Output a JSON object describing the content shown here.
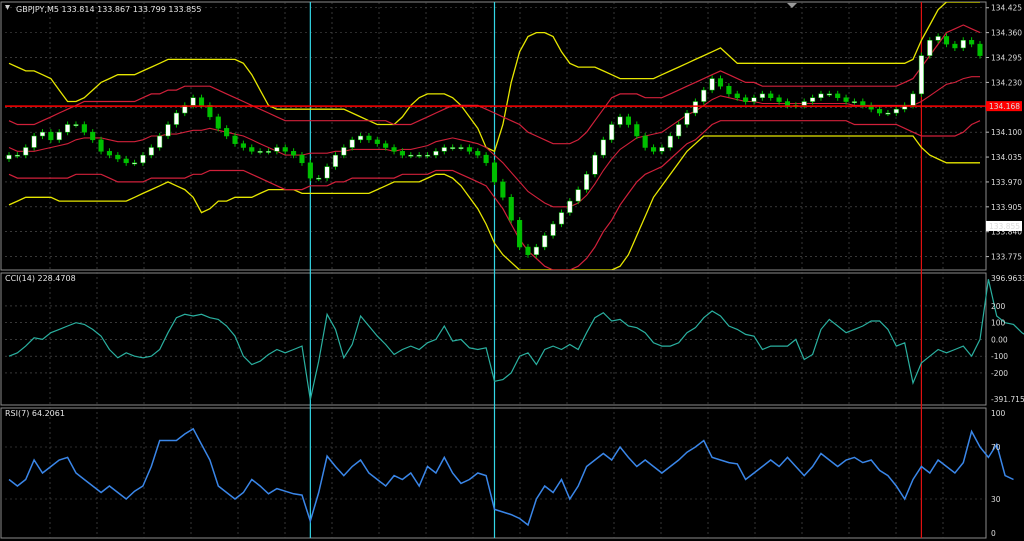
{
  "window": {
    "header": "GBPJPY,M5  133.814 133.867 133.799 133.855"
  },
  "colors": {
    "background": "#000000",
    "grid": "#5a5a5a",
    "bull_candle": "#ffffff",
    "bear_candle": "#00c000",
    "band_outer": "#e6e600",
    "band_inner": "#d0203a",
    "cci_line": "#2ab0a0",
    "rsi_line": "#3a86e8",
    "marker_cyan": "#33d6e6",
    "marker_red": "#e01010",
    "hline_red": "#ff0000"
  },
  "chart_data": [
    {
      "type": "candlestick",
      "symbol": "GBPJPY",
      "timeframe": "M5",
      "ylim": [
        133.74,
        134.44
      ],
      "ticks": [
        "134.425",
        "134.360",
        "134.295",
        "134.230",
        "134.165",
        "134.100",
        "134.035",
        "133.970",
        "133.905",
        "133.840",
        "133.775"
      ],
      "price_line": {
        "value": 134.168,
        "label": "134.168"
      },
      "bid_label": {
        "value": 133.855,
        "label": "133.855"
      },
      "closes": [
        134.04,
        134.04,
        134.06,
        134.09,
        134.1,
        134.08,
        134.1,
        134.12,
        134.12,
        134.1,
        134.08,
        134.05,
        134.04,
        134.03,
        134.02,
        134.02,
        134.04,
        134.06,
        134.09,
        134.12,
        134.15,
        134.17,
        134.19,
        134.17,
        134.14,
        134.11,
        134.09,
        134.07,
        134.06,
        134.05,
        134.05,
        134.05,
        134.06,
        134.05,
        134.04,
        134.02,
        133.98,
        133.98,
        134.01,
        134.04,
        134.06,
        134.08,
        134.09,
        134.08,
        134.07,
        134.06,
        134.05,
        134.04,
        134.04,
        134.04,
        134.04,
        134.05,
        134.06,
        134.06,
        134.06,
        134.05,
        134.04,
        134.02,
        133.97,
        133.93,
        133.87,
        133.8,
        133.78,
        133.8,
        133.83,
        133.86,
        133.89,
        133.92,
        133.95,
        133.99,
        134.04,
        134.08,
        134.12,
        134.14,
        134.12,
        134.09,
        134.06,
        134.05,
        134.06,
        134.09,
        134.12,
        134.15,
        134.18,
        134.21,
        134.24,
        134.22,
        134.2,
        134.19,
        134.18,
        134.19,
        134.2,
        134.19,
        134.18,
        134.17,
        134.17,
        134.18,
        134.19,
        134.2,
        134.2,
        134.19,
        134.18,
        134.18,
        134.17,
        134.16,
        134.15,
        134.15,
        134.16,
        134.17,
        134.2,
        134.3,
        134.34,
        134.35,
        134.33,
        134.32,
        134.34,
        134.33,
        134.3
      ],
      "band_inner_upper": [
        134.13,
        134.12,
        134.12,
        134.12,
        134.13,
        134.14,
        134.15,
        134.16,
        134.17,
        134.18,
        134.18,
        134.18,
        134.18,
        134.18,
        134.18,
        134.18,
        134.19,
        134.2,
        134.2,
        134.21,
        134.21,
        134.22,
        134.22,
        134.22,
        134.22,
        134.21,
        134.2,
        134.19,
        134.18,
        134.17,
        134.16,
        134.15,
        134.14,
        134.13,
        134.13,
        134.13,
        134.13,
        134.13,
        134.13,
        134.13,
        134.13,
        134.13,
        134.13,
        134.13,
        134.13,
        134.13,
        134.12,
        134.12,
        134.12,
        134.13,
        134.14,
        134.15,
        134.16,
        134.17,
        134.17,
        134.17,
        134.17,
        134.16,
        134.15,
        134.14,
        134.13,
        134.12,
        134.1,
        134.09,
        134.08,
        134.07,
        134.07,
        134.07,
        134.08,
        134.1,
        134.13,
        134.16,
        134.19,
        134.2,
        134.2,
        134.2,
        134.19,
        134.19,
        134.19,
        134.2,
        134.21,
        134.22,
        134.23,
        134.24,
        134.25,
        134.26,
        134.25,
        134.24,
        134.23,
        134.23,
        134.22,
        134.22,
        134.22,
        134.22,
        134.22,
        134.22,
        134.22,
        134.22,
        134.22,
        134.22,
        134.22,
        134.22,
        134.22,
        134.22,
        134.22,
        134.22,
        134.22,
        134.23,
        134.24,
        134.27,
        134.3,
        134.33,
        134.36,
        134.37,
        134.38,
        134.37,
        134.36
      ],
      "band_inner_lower": [
        133.99,
        133.98,
        133.98,
        133.98,
        133.98,
        133.98,
        133.98,
        133.98,
        133.99,
        133.99,
        133.99,
        133.99,
        133.98,
        133.97,
        133.97,
        133.97,
        133.97,
        133.98,
        133.98,
        133.98,
        133.98,
        133.98,
        133.99,
        133.99,
        134.0,
        134.0,
        134.0,
        134.0,
        134.0,
        133.99,
        133.98,
        133.97,
        133.96,
        133.95,
        133.95,
        133.95,
        133.96,
        133.96,
        133.96,
        133.97,
        133.97,
        133.98,
        133.98,
        133.98,
        133.98,
        133.98,
        133.98,
        133.99,
        133.99,
        133.99,
        133.99,
        134.0,
        134.0,
        134.0,
        133.99,
        133.98,
        133.97,
        133.96,
        133.93,
        133.9,
        133.86,
        133.82,
        133.79,
        133.77,
        133.75,
        133.74,
        133.74,
        133.74,
        133.75,
        133.77,
        133.8,
        133.84,
        133.87,
        133.91,
        133.94,
        133.97,
        133.99,
        134.0,
        134.01,
        134.03,
        134.05,
        134.07,
        134.08,
        134.1,
        134.12,
        134.13,
        134.13,
        134.13,
        134.13,
        134.13,
        134.13,
        134.13,
        134.13,
        134.13,
        134.13,
        134.13,
        134.13,
        134.13,
        134.13,
        134.13,
        134.13,
        134.12,
        134.12,
        134.12,
        134.12,
        134.12,
        134.12,
        134.11,
        134.1,
        134.09,
        134.09,
        134.09,
        134.09,
        134.09,
        134.1,
        134.12,
        134.13
      ],
      "band_outer_upper": [
        134.28,
        134.27,
        134.26,
        134.26,
        134.25,
        134.24,
        134.21,
        134.18,
        134.18,
        134.19,
        134.21,
        134.23,
        134.24,
        134.25,
        134.25,
        134.25,
        134.26,
        134.27,
        134.28,
        134.29,
        134.29,
        134.29,
        134.29,
        134.29,
        134.29,
        134.29,
        134.29,
        134.29,
        134.28,
        134.25,
        134.21,
        134.17,
        134.16,
        134.16,
        134.16,
        134.16,
        134.16,
        134.16,
        134.16,
        134.16,
        134.16,
        134.15,
        134.14,
        134.13,
        134.12,
        134.12,
        134.12,
        134.14,
        134.17,
        134.19,
        134.2,
        134.2,
        134.2,
        134.19,
        134.17,
        134.14,
        134.11,
        134.06,
        134.05,
        134.12,
        134.23,
        134.31,
        134.35,
        134.36,
        134.36,
        134.35,
        134.31,
        134.28,
        134.27,
        134.27,
        134.27,
        134.26,
        134.25,
        134.24,
        134.24,
        134.24,
        134.24,
        134.24,
        134.25,
        134.26,
        134.27,
        134.28,
        134.29,
        134.3,
        134.31,
        134.32,
        134.3,
        134.28,
        134.28,
        134.28,
        134.28,
        134.28,
        134.28,
        134.28,
        134.28,
        134.28,
        134.28,
        134.28,
        134.28,
        134.28,
        134.28,
        134.28,
        134.28,
        134.28,
        134.28,
        134.28,
        134.28,
        134.28,
        134.29,
        134.34,
        134.38,
        134.42,
        134.44,
        134.44,
        134.44,
        134.44,
        134.44
      ],
      "band_outer_lower": [
        133.91,
        133.92,
        133.93,
        133.93,
        133.93,
        133.93,
        133.92,
        133.92,
        133.92,
        133.92,
        133.92,
        133.92,
        133.92,
        133.92,
        133.92,
        133.93,
        133.94,
        133.95,
        133.96,
        133.97,
        133.96,
        133.95,
        133.93,
        133.89,
        133.9,
        133.92,
        133.92,
        133.93,
        133.93,
        133.93,
        133.94,
        133.95,
        133.95,
        133.95,
        133.95,
        133.94,
        133.94,
        133.94,
        133.94,
        133.94,
        133.94,
        133.94,
        133.94,
        133.94,
        133.95,
        133.96,
        133.97,
        133.97,
        133.97,
        133.97,
        133.98,
        133.99,
        133.99,
        133.98,
        133.96,
        133.93,
        133.9,
        133.86,
        133.81,
        133.78,
        133.76,
        133.74,
        133.74,
        133.74,
        133.74,
        133.74,
        133.74,
        133.74,
        133.74,
        133.74,
        133.74,
        133.74,
        133.74,
        133.75,
        133.78,
        133.83,
        133.88,
        133.93,
        133.96,
        133.99,
        134.02,
        134.05,
        134.07,
        134.09,
        134.09,
        134.09,
        134.09,
        134.09,
        134.09,
        134.09,
        134.09,
        134.09,
        134.09,
        134.09,
        134.09,
        134.09,
        134.09,
        134.09,
        134.09,
        134.09,
        134.09,
        134.09,
        134.09,
        134.09,
        134.09,
        134.09,
        134.09,
        134.09,
        134.09,
        134.06,
        134.04,
        134.03,
        134.02,
        134.02,
        134.02,
        134.02,
        134.02
      ]
    },
    {
      "type": "line",
      "title": "CCI(14) 228.4708",
      "ylim": [
        -391.7154,
        396.9633
      ],
      "ticks": [
        "396.9633",
        "200",
        "100",
        "0.00",
        "-100",
        "-200",
        "-391.7154"
      ],
      "tick_values": [
        396.9633,
        200,
        100,
        0,
        -100,
        -200,
        -391.7154
      ],
      "values": [
        -100,
        -80,
        -40,
        10,
        0,
        40,
        60,
        80,
        100,
        90,
        60,
        20,
        -60,
        -110,
        -80,
        -100,
        -110,
        -100,
        -60,
        40,
        130,
        150,
        140,
        150,
        130,
        120,
        80,
        20,
        -100,
        -150,
        -130,
        -90,
        -60,
        -80,
        -60,
        -40,
        -360,
        -130,
        150,
        60,
        -110,
        -30,
        140,
        80,
        20,
        -30,
        -90,
        -60,
        -40,
        -60,
        -20,
        0,
        80,
        -10,
        0,
        -50,
        -60,
        -50,
        -250,
        -240,
        -200,
        -100,
        -80,
        -150,
        -60,
        -40,
        -60,
        -30,
        -60,
        40,
        130,
        160,
        110,
        120,
        80,
        70,
        40,
        -20,
        -40,
        -40,
        -20,
        40,
        70,
        130,
        170,
        140,
        80,
        60,
        30,
        20,
        -60,
        -40,
        -40,
        -40,
        0,
        -120,
        -90,
        60,
        120,
        80,
        40,
        60,
        80,
        110,
        110,
        60,
        -40,
        -20,
        -260,
        -140,
        -100,
        -60,
        -80,
        -60,
        -40,
        -100,
        0,
        360,
        140,
        100,
        90,
        40,
        10
      ]
    },
    {
      "type": "line",
      "title": "RSI(7) 64.2061",
      "ylim": [
        0,
        100
      ],
      "ticks": [
        "100",
        "70",
        "30",
        "0"
      ],
      "tick_values": [
        100,
        70,
        30,
        0
      ],
      "values": [
        45,
        40,
        45,
        60,
        50,
        55,
        60,
        62,
        50,
        45,
        40,
        35,
        40,
        35,
        30,
        36,
        40,
        55,
        75,
        75,
        75,
        80,
        84,
        72,
        60,
        40,
        35,
        30,
        35,
        45,
        40,
        34,
        38,
        36,
        34,
        33,
        13,
        35,
        63,
        55,
        48,
        55,
        60,
        50,
        45,
        40,
        48,
        45,
        50,
        40,
        55,
        50,
        62,
        50,
        42,
        45,
        50,
        48,
        22,
        20,
        18,
        15,
        10,
        30,
        40,
        35,
        45,
        30,
        40,
        55,
        60,
        65,
        60,
        70,
        62,
        55,
        60,
        55,
        50,
        55,
        60,
        66,
        70,
        75,
        62,
        60,
        58,
        57,
        45,
        50,
        55,
        60,
        55,
        62,
        55,
        48,
        55,
        65,
        60,
        55,
        60,
        62,
        58,
        60,
        52,
        48,
        40,
        30,
        45,
        55,
        50,
        60,
        55,
        50,
        58,
        82,
        70,
        62,
        72,
        48,
        45
      ]
    }
  ]
}
